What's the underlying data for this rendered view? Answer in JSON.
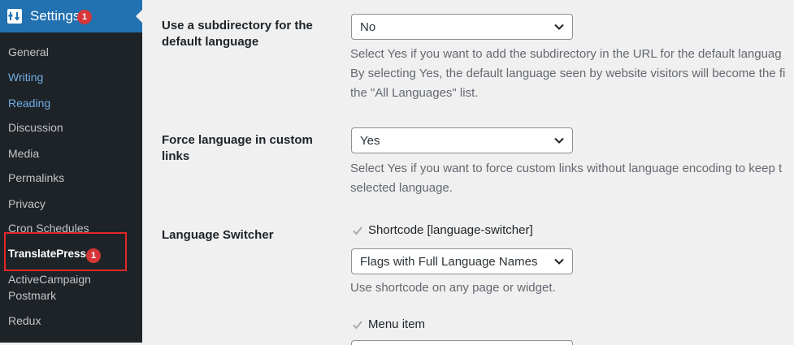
{
  "sidebar": {
    "settings": {
      "label": "Settings",
      "badge": "1"
    },
    "items": [
      {
        "label": "General"
      },
      {
        "label": "Writing"
      },
      {
        "label": "Reading"
      },
      {
        "label": "Discussion"
      },
      {
        "label": "Media"
      },
      {
        "label": "Permalinks"
      },
      {
        "label": "Privacy"
      },
      {
        "label": "Cron Schedules"
      },
      {
        "label": "TranslatePress",
        "badge": "1"
      },
      {
        "label": "ActiveCampaign"
      },
      {
        "label": "Postmark"
      },
      {
        "label": "Redux"
      }
    ]
  },
  "settings": {
    "subdirectory": {
      "label_line1": "Use a subdirectory for the",
      "label_line2": "default language",
      "value": "No",
      "desc_line1": "Select Yes if you want to add the subdirectory in the URL for the default languag",
      "desc_line2": "By selecting Yes, the default language seen by website visitors will become the fi",
      "desc_line3": "the \"All Languages\" list."
    },
    "force_language": {
      "label_line1": "Force language in custom",
      "label_line2": "links",
      "value": "Yes",
      "desc_line1": "Select Yes if you want to force custom links without language encoding to keep t",
      "desc_line2": "selected language."
    },
    "language_switcher": {
      "label": "Language Switcher",
      "shortcode_label": "Shortcode [language-switcher]",
      "shortcode_value": "Flags with Full Language Names",
      "shortcode_desc": "Use shortcode on any page or widget.",
      "menu_item_label": "Menu item"
    }
  },
  "colors": {
    "sidebar_bg": "#1d2327",
    "accent": "#2271b1",
    "badge": "#d63638",
    "highlight_box": "#e0272b"
  }
}
